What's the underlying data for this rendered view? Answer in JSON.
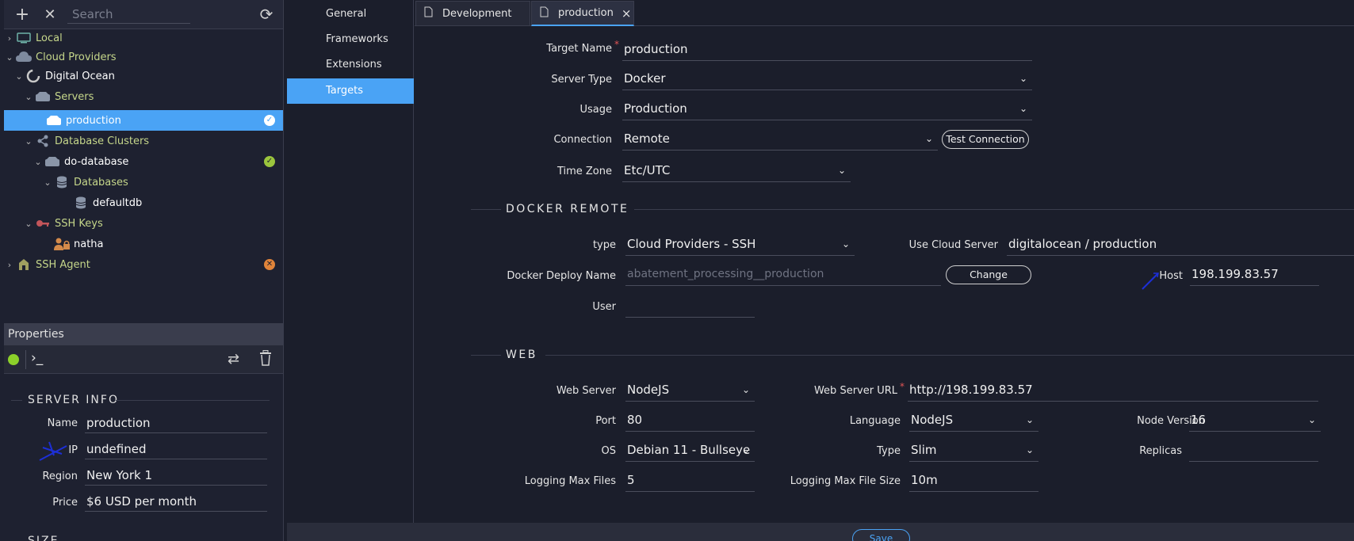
{
  "toolbar": {
    "search_placeholder": "Search"
  },
  "tree": {
    "local": "Local",
    "cloud_providers": "Cloud Providers",
    "digital_ocean": "Digital Ocean",
    "servers": "Servers",
    "production": "production",
    "database_clusters": "Database Clusters",
    "do_database": "do-database",
    "databases": "Databases",
    "defaultdb": "defaultdb",
    "ssh_keys": "SSH Keys",
    "natha": "natha",
    "ssh_agent": "SSH Agent"
  },
  "properties": {
    "header": "Properties",
    "terminal_glyph": "›_",
    "server_info_title": "SERVER INFO",
    "name_label": "Name",
    "name_value": "production",
    "ip_label": "IP",
    "ip_value": "undefined",
    "region_label": "Region",
    "region_value": "New York 1",
    "price_label": "Price",
    "price_value": "$6 USD per month",
    "size_title": "SIZE"
  },
  "nav": {
    "general": "General",
    "frameworks": "Frameworks",
    "extensions": "Extensions",
    "targets": "Targets"
  },
  "tabs": {
    "development": "Development",
    "production": "production",
    "close": "×"
  },
  "form": {
    "target_name_label": "Target Name",
    "target_name_value": "production",
    "server_type_label": "Server Type",
    "server_type_value": "Docker",
    "usage_label": "Usage",
    "usage_value": "Production",
    "connection_label": "Connection",
    "connection_value": "Remote",
    "test_connection": "Test Connection",
    "timezone_label": "Time Zone",
    "timezone_value": "Etc/UTC"
  },
  "docker_remote": {
    "title": "DOCKER REMOTE",
    "type_label": "type",
    "type_value": "Cloud Providers - SSH",
    "use_cloud_server_label": "Use Cloud Server",
    "use_cloud_server_value": "digitalocean / production",
    "deploy_name_label": "Docker Deploy Name",
    "deploy_name_placeholder": "abatement_processing__production",
    "change_button": "Change",
    "host_label": "Host",
    "host_value": "198.199.83.57",
    "user_label": "User",
    "user_value": ""
  },
  "web": {
    "title": "WEB",
    "web_server_label": "Web Server",
    "web_server_value": "NodeJS",
    "web_server_url_label": "Web Server URL",
    "web_server_url_value": "http://198.199.83.57",
    "port_label": "Port",
    "port_value": "80",
    "language_label": "Language",
    "language_value": "NodeJS",
    "node_version_label": "Node Version",
    "node_version_value": "16",
    "os_label": "OS",
    "os_value": "Debian 11 - Bullseye",
    "type_label": "Type",
    "type_value": "Slim",
    "replicas_label": "Replicas",
    "replicas_value": "",
    "logging_max_files_label": "Logging Max Files",
    "logging_max_files_value": "5",
    "logging_max_file_size_label": "Logging Max File Size",
    "logging_max_file_size_value": "10m"
  },
  "footer": {
    "save": "Save"
  },
  "colors": {
    "accent": "#4aa3f5",
    "tree_green": "#c5d68a",
    "ok": "#9bc53d",
    "error": "#e0843a"
  }
}
